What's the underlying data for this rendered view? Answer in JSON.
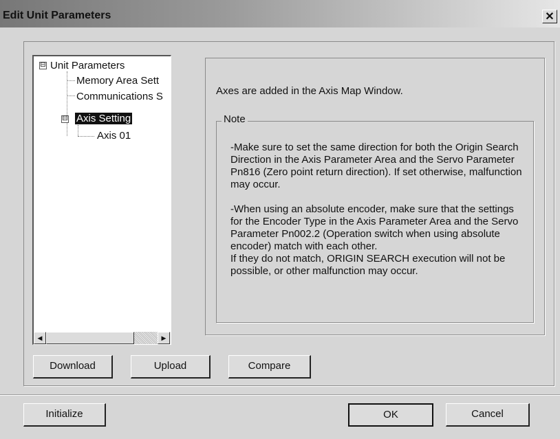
{
  "window": {
    "title": "Edit Unit Parameters",
    "close_glyph": "✕"
  },
  "tree": {
    "items": [
      {
        "label": "Unit Parameters",
        "expander": "⊟"
      },
      {
        "label": "Memory Area Sett"
      },
      {
        "label": "Communications S"
      },
      {
        "label": "Axis Setting",
        "expander": "⊟",
        "selected": true
      },
      {
        "label": "Axis 01"
      }
    ],
    "scroll_left_icon": "◀",
    "scroll_right_icon": "▶"
  },
  "info": {
    "message": "Axes are added in the Axis Map Window."
  },
  "note": {
    "legend": "Note",
    "body": "-Make sure to set the same direction for both the Origin Search Direction in the Axis Parameter Area and the Servo Parameter Pn816 (Zero point return direction). If set otherwise, malfunction may occur.\n\n -When using an absolute encoder, make sure that the settings for the Encoder Type in the Axis Parameter Area and the Servo Parameter Pn002.2 (Operation switch when using absolute encoder) match with each other.\nIf they do not match, ORIGIN SEARCH execution will not be possible, or other malfunction may occur."
  },
  "buttons": {
    "download": "Download",
    "upload": "Upload",
    "compare": "Compare",
    "initialize": "Initialize",
    "ok": "OK",
    "cancel": "Cancel"
  }
}
